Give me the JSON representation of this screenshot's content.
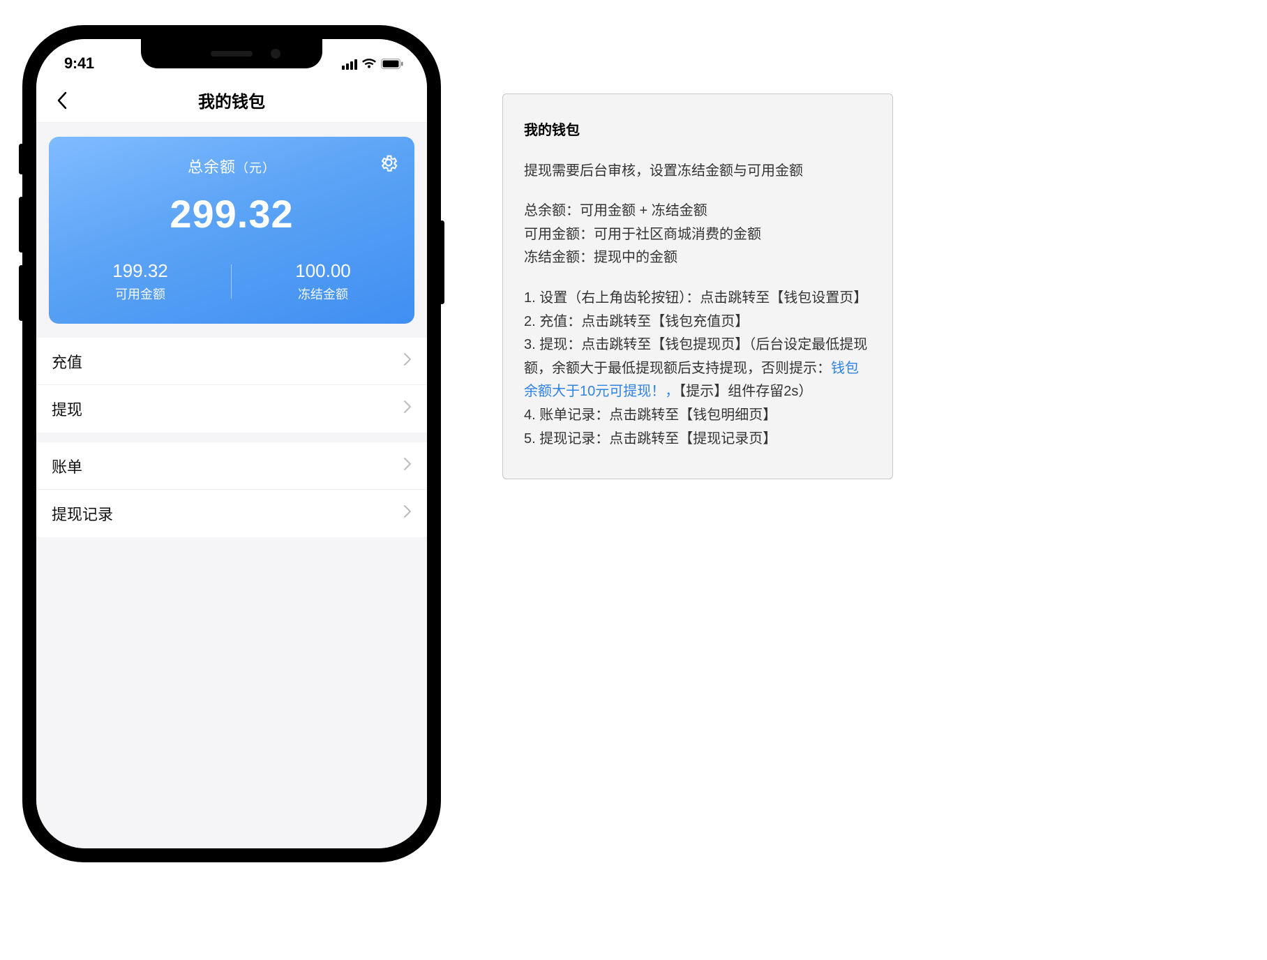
{
  "status_bar": {
    "time": "9:41"
  },
  "nav": {
    "title": "我的钱包"
  },
  "balance": {
    "title": "总余额",
    "unit": "（元）",
    "amount": "299.32",
    "available_value": "199.32",
    "available_label": "可用金额",
    "frozen_value": "100.00",
    "frozen_label": "冻结金额"
  },
  "menu": {
    "group1": [
      {
        "label": "充值"
      },
      {
        "label": "提现"
      }
    ],
    "group2": [
      {
        "label": "账单"
      },
      {
        "label": "提现记录"
      }
    ]
  },
  "note": {
    "title": "我的钱包",
    "p1": "提现需要后台审核，设置冻结金额与可用金额",
    "defs": {
      "l1": "总余额：可用金额 + 冻结金额",
      "l2": "可用金额：可用于社区商城消费的金额",
      "l3": "冻结金额：提现中的金额"
    },
    "items": {
      "i1a": "1. 设置（右上角齿轮按钮）：点击跳转至【钱包设置页】",
      "i2": "2. 充值：点击跳转至【钱包充值页】",
      "i3a": "3. 提现：点击跳转至【钱包提现页】（后台设定最低提现额，余额大于最低提现额后支持提现，否则提示：",
      "i3blue": "钱包余额大于10元可提现！，",
      "i3b": "【提示】组件存留2s）",
      "i4": "4. 账单记录：点击跳转至【钱包明细页】",
      "i5": "5. 提现记录：点击跳转至【提现记录页】"
    }
  }
}
